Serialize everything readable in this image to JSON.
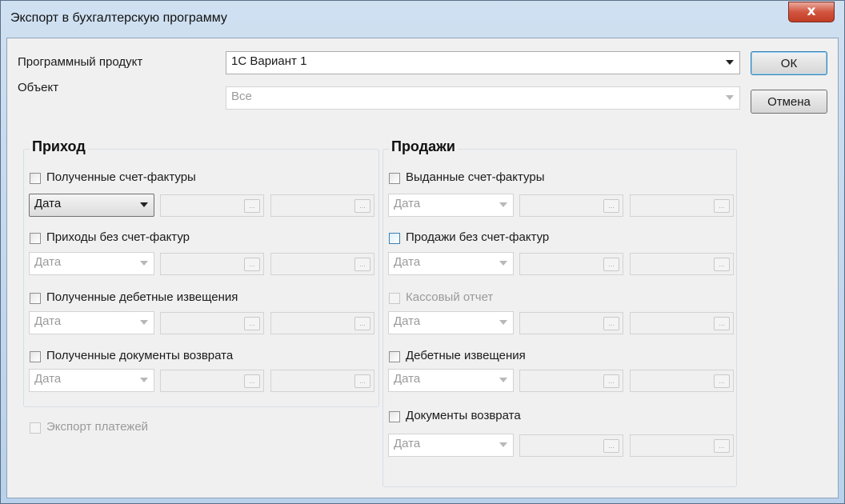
{
  "window": {
    "title": "Экспорт в бухгалтерскую программу",
    "close_glyph": "x"
  },
  "form": {
    "product_label": "Программный продукт",
    "product_value": "1С Вариант 1",
    "object_label": "Объект",
    "object_value": "Все"
  },
  "buttons": {
    "ok": "ОК",
    "cancel": "Отмена"
  },
  "income": {
    "title": "Приход",
    "rows": [
      {
        "label": "Полученные счет-фактуры",
        "date": "Дата"
      },
      {
        "label": "Приходы без счет-фактур",
        "date": "Дата"
      },
      {
        "label": "Полученные дебетные извещения",
        "date": "Дата"
      },
      {
        "label": "Полученные документы возврата",
        "date": "Дата"
      }
    ]
  },
  "sales": {
    "title": "Продажи",
    "rows": [
      {
        "label": "Выданные счет-фактуры",
        "date": "Дата"
      },
      {
        "label": "Продажи без счет-фактур",
        "date": "Дата"
      },
      {
        "label": "Кассовый отчет",
        "date": "Дата"
      },
      {
        "label": "Дебетные извещения",
        "date": "Дата"
      },
      {
        "label": "Документы возврата",
        "date": "Дата"
      }
    ]
  },
  "export_payments": "Экспорт платежей",
  "ellipsis": "...",
  "colors": {
    "title_bar": "#cfe0f1",
    "close_button": "#c13d25",
    "dialog_bg": "#f0f0f0"
  }
}
